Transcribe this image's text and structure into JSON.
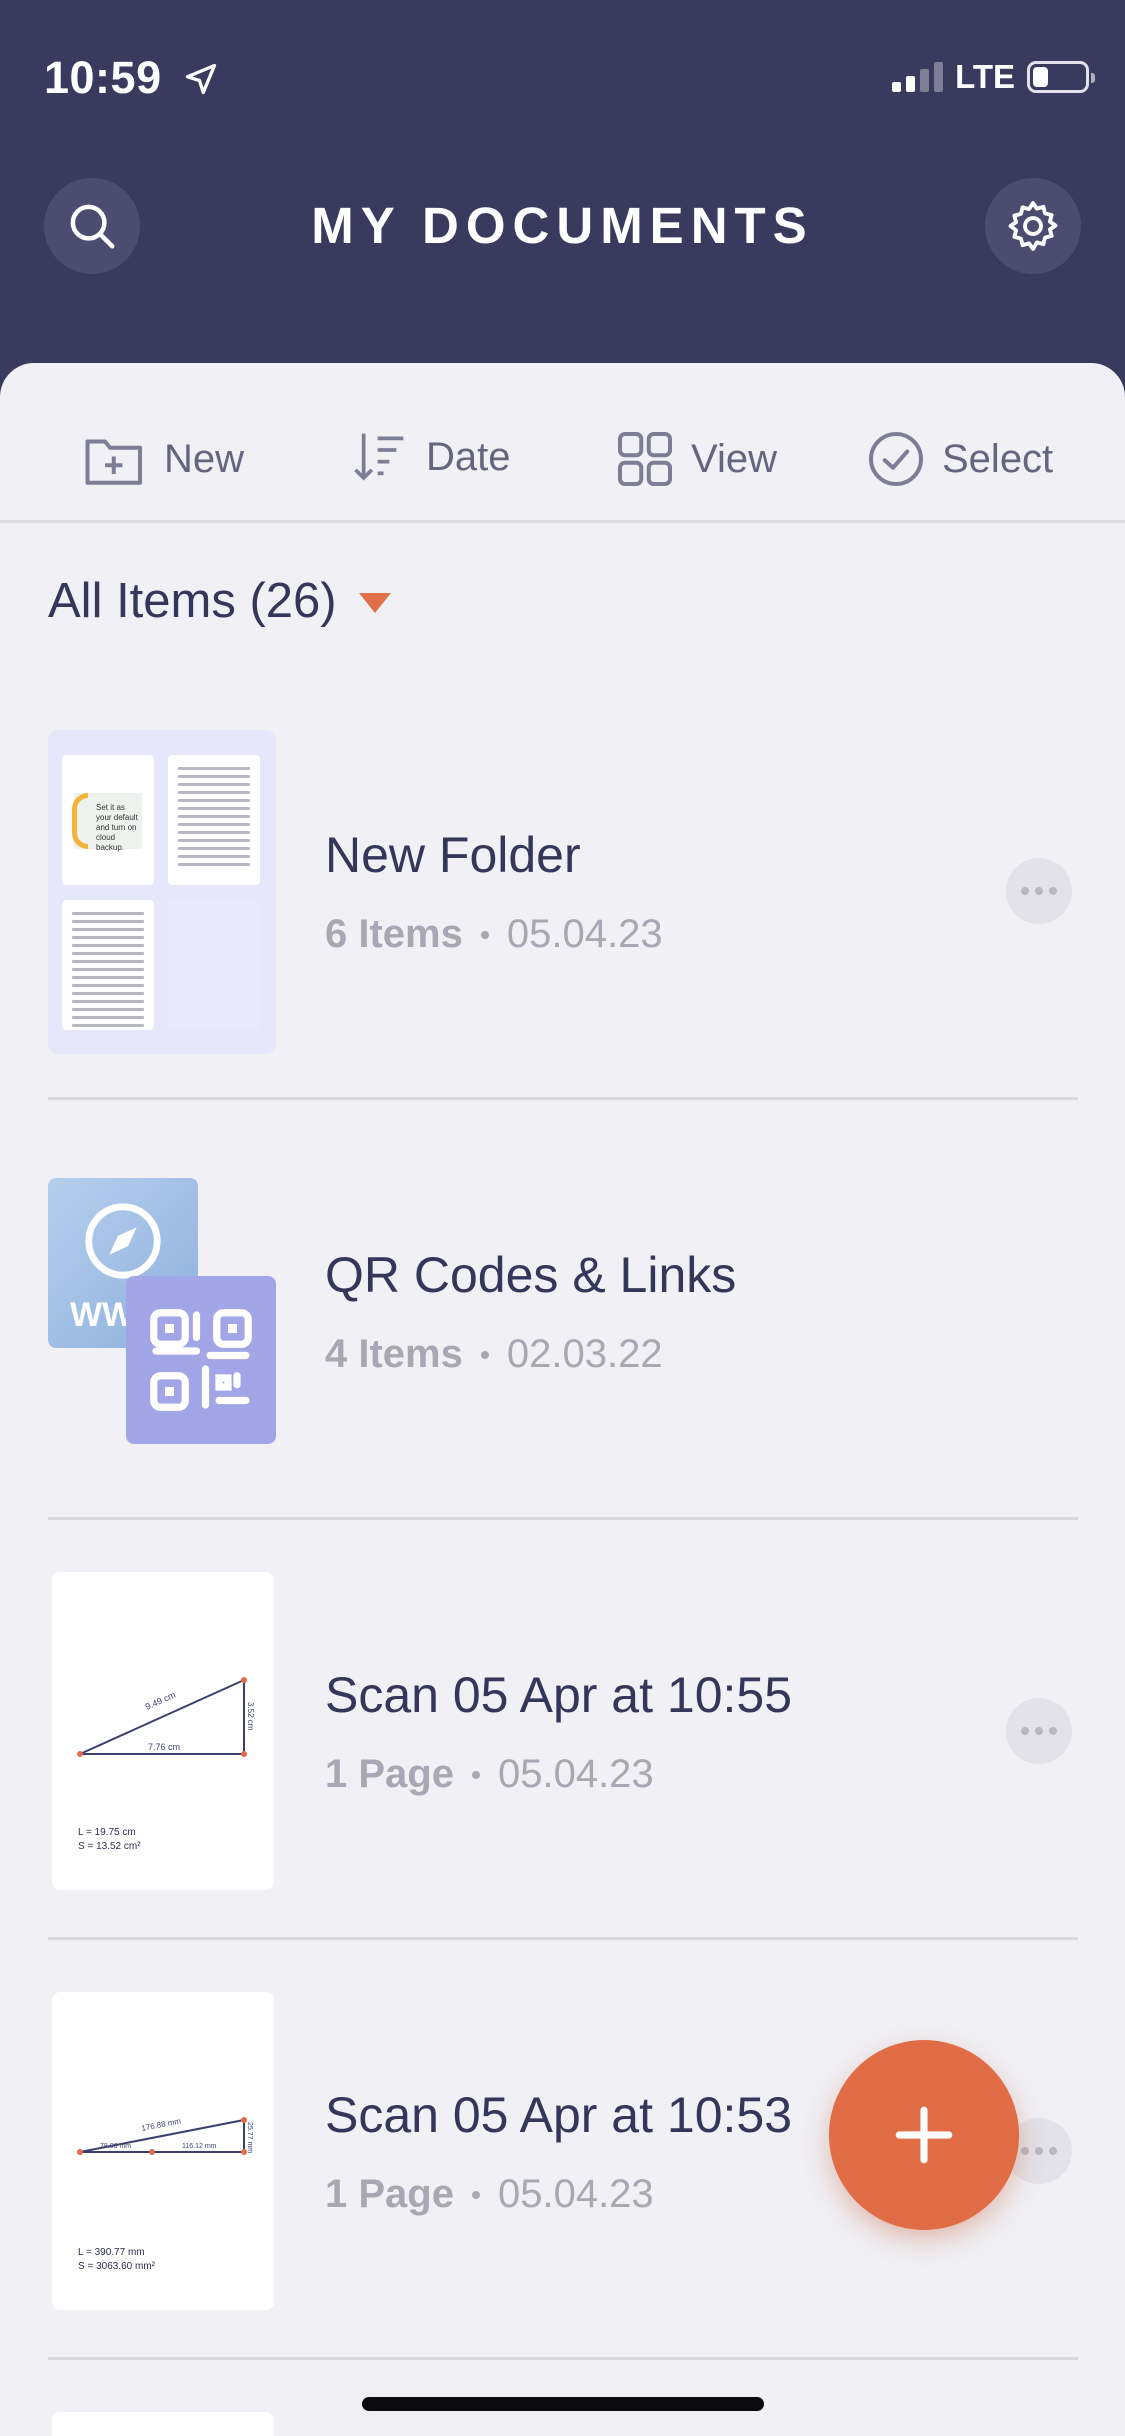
{
  "status_bar": {
    "time": "10:59",
    "network": "LTE"
  },
  "header": {
    "title": "MY DOCUMENTS",
    "search_icon": "search-icon",
    "settings_icon": "gear-icon"
  },
  "toolbar": {
    "new_label": "New",
    "date_label": "Date",
    "view_label": "View",
    "select_label": "Select"
  },
  "filter": {
    "label": "All Items (26)"
  },
  "items": [
    {
      "name": "New Folder",
      "count": "6 Items",
      "date": "05.04.23",
      "type": "folder"
    },
    {
      "name": "QR Codes & Links",
      "count": "4 Items",
      "date": "02.03.22",
      "type": "qr-folder"
    },
    {
      "name": "Scan 05 Apr at 10:55",
      "count": "1 Page",
      "date": "05.04.23",
      "type": "scan",
      "thumb": {
        "hyp": "9.49 cm",
        "base": "7.76 cm",
        "side": "3.52 cm",
        "L": "L = 19.75 cm",
        "S": "S = 13.52 cm²"
      }
    },
    {
      "name": "Scan 05 Apr at 10:53",
      "count": "1 Page",
      "date": "05.04.23",
      "type": "scan",
      "thumb": {
        "hyp": "176.88 mm",
        "base": "116.12 mm",
        "base2": "78.00 mm",
        "side": "25.77 mm",
        "L": "L = 390.77 mm",
        "S": "S = 3063.60 mm²"
      }
    }
  ],
  "thumb_text": {
    "folder_page1": "Set it as your default and turn on cloud backup.",
    "web": "WWW"
  },
  "fab": {
    "icon": "plus-icon"
  },
  "colors": {
    "header_bg": "#393a5e",
    "sheet_bg": "#f0f0f5",
    "accent": "#e06d46",
    "text": "#35365a",
    "muted": "#a8a8b4"
  }
}
